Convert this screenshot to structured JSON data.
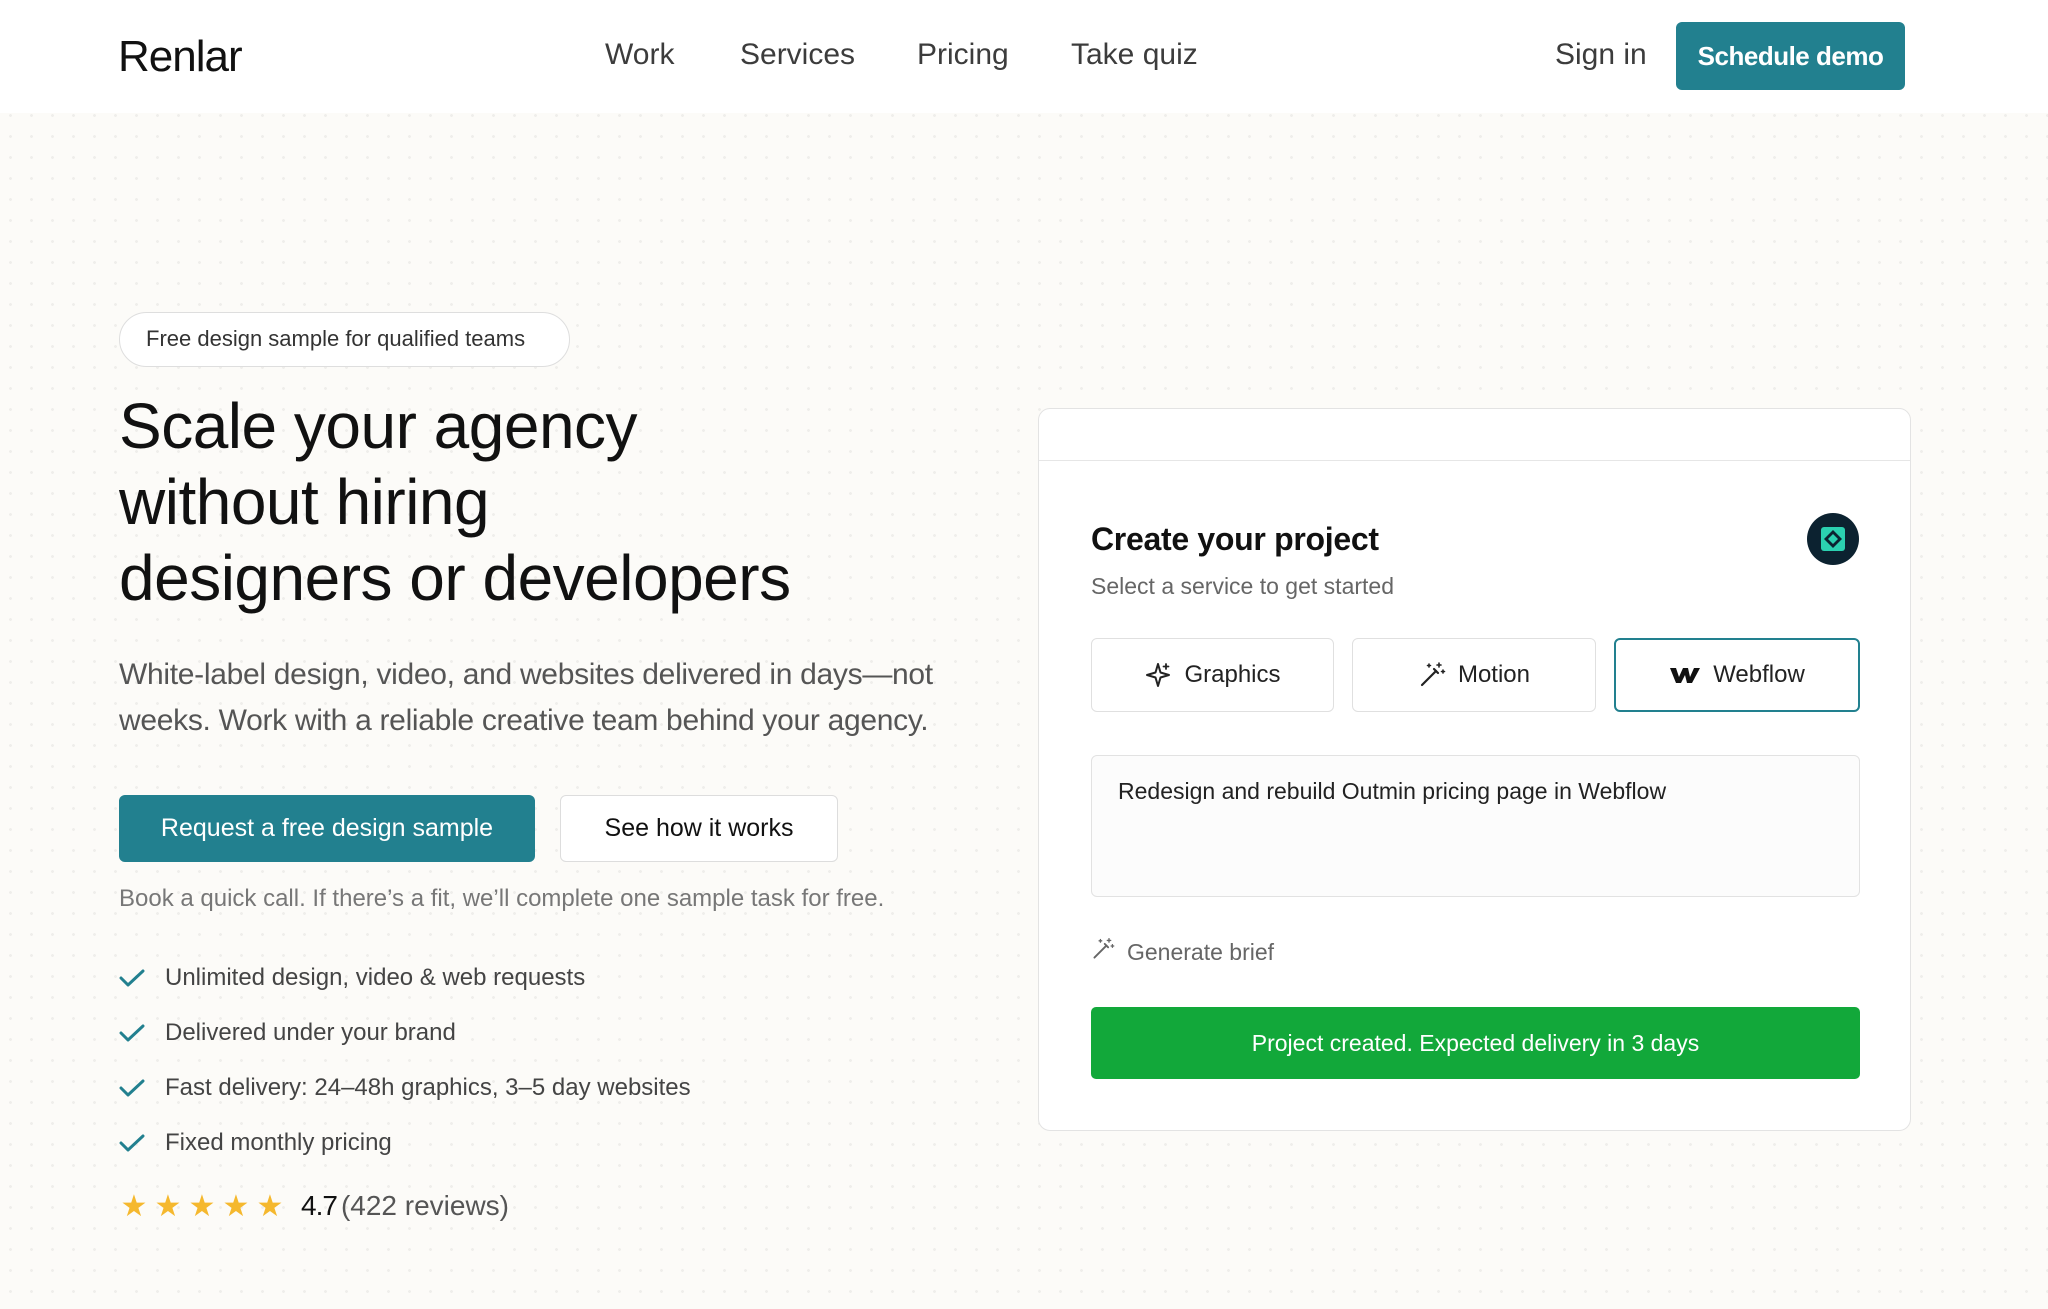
{
  "header": {
    "logo": "Renlar",
    "nav": [
      {
        "label": "Work"
      },
      {
        "label": "Services"
      },
      {
        "label": "Pricing"
      },
      {
        "label": "Take quiz"
      }
    ],
    "sign_in": "Sign in",
    "demo_button": "Schedule demo"
  },
  "hero": {
    "badge": "Free design sample for qualified teams",
    "headline": [
      "Scale your agency",
      "without hiring",
      "designers or developers"
    ],
    "subtext": [
      "White-label design, video, and websites delivered in days—not",
      "weeks. Work with a reliable creative team behind your agency."
    ],
    "primary_cta": "Request a free design sample",
    "secondary_cta": "See how it works",
    "cta_note": "Book a quick call. If there’s a fit, we’ll complete one sample task for free.",
    "features": [
      "Unlimited design, video & web requests",
      "Delivered under your brand",
      "Fast delivery: 24–48h graphics, 3–5 day websites",
      "Fixed monthly pricing"
    ],
    "rating": {
      "value": "4.7",
      "count": "(422 reviews)",
      "stars": 5
    }
  },
  "project_card": {
    "title": "Create your project",
    "subtitle": "Select a service to get started",
    "services": [
      {
        "label": "Graphics",
        "icon": "sparkle-icon",
        "selected": false
      },
      {
        "label": "Motion",
        "icon": "magic-wand-icon",
        "selected": false
      },
      {
        "label": "Webflow",
        "icon": "webflow-icon",
        "selected": true
      }
    ],
    "brief_text": "Redesign and rebuild Outmin pricing page in Webflow",
    "generate_label": "Generate brief",
    "status": "Project created. Expected delivery in 3 days"
  },
  "colors": {
    "accent": "#22808f",
    "success": "#12a83a",
    "star": "#f5b82e"
  }
}
